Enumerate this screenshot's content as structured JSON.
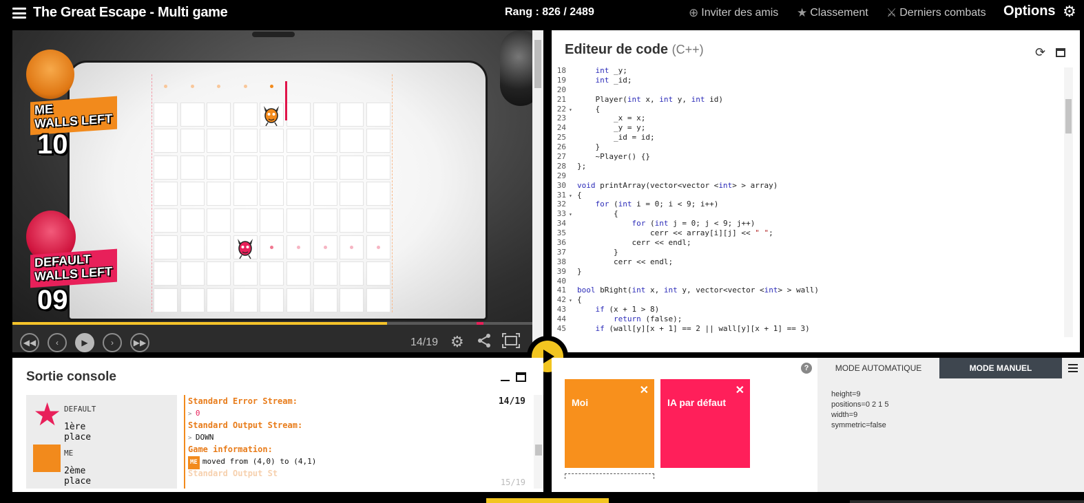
{
  "app": {
    "title": "The Great Escape - Multi game",
    "rank": "Rang : 826 / 2489",
    "links": {
      "invite": "Inviter des amis",
      "ranking": "Classement",
      "fights": "Derniers combats"
    },
    "options": "Options"
  },
  "viewer": {
    "hud": {
      "me": {
        "name": "ME",
        "walls_label": "WALLS LEFT",
        "walls_left": "10"
      },
      "default": {
        "name": "DEFAULT",
        "walls_label": "WALLS LEFT",
        "walls_left": "09"
      }
    },
    "frame": "14/19",
    "progress": 0.72,
    "board_size": 9,
    "me_pawn": {
      "col": 4,
      "row": 1
    },
    "default_pawn": {
      "col": 3,
      "row": 6
    },
    "wall": {
      "col": 5,
      "row": 0,
      "span": 2,
      "orientation": "V"
    }
  },
  "editor": {
    "title": "Editeur de code",
    "lang": "(C++)",
    "lines": [
      {
        "n": "18",
        "fold": "",
        "t": "    int _y;"
      },
      {
        "n": "19",
        "fold": "",
        "t": "    int _id;"
      },
      {
        "n": "20",
        "fold": "",
        "t": ""
      },
      {
        "n": "21",
        "fold": "",
        "t": "    Player(int x, int y, int id)"
      },
      {
        "n": "22",
        "fold": "▾",
        "t": "    {"
      },
      {
        "n": "23",
        "fold": "",
        "t": "        _x = x;"
      },
      {
        "n": "24",
        "fold": "",
        "t": "        _y = y;"
      },
      {
        "n": "25",
        "fold": "",
        "t": "        _id = id;"
      },
      {
        "n": "26",
        "fold": "",
        "t": "    }"
      },
      {
        "n": "27",
        "fold": "",
        "t": "    ~Player() {}"
      },
      {
        "n": "28",
        "fold": "",
        "t": "};"
      },
      {
        "n": "29",
        "fold": "",
        "t": ""
      },
      {
        "n": "30",
        "fold": "",
        "t": "void printArray(vector<vector <int> > array)"
      },
      {
        "n": "31",
        "fold": "▾",
        "t": "{"
      },
      {
        "n": "32",
        "fold": "",
        "t": "    for (int i = 0; i < 9; i++)"
      },
      {
        "n": "33",
        "fold": "▾",
        "t": "        {"
      },
      {
        "n": "34",
        "fold": "",
        "t": "            for (int j = 0; j < 9; j++)"
      },
      {
        "n": "35",
        "fold": "",
        "t": "                cerr << array[i][j] << \" \";"
      },
      {
        "n": "36",
        "fold": "",
        "t": "            cerr << endl;"
      },
      {
        "n": "37",
        "fold": "",
        "t": "        }"
      },
      {
        "n": "38",
        "fold": "",
        "t": "        cerr << endl;"
      },
      {
        "n": "39",
        "fold": "",
        "t": "}"
      },
      {
        "n": "40",
        "fold": "",
        "t": ""
      },
      {
        "n": "41",
        "fold": "",
        "t": "bool bRight(int x, int y, vector<vector <int> > wall)"
      },
      {
        "n": "42",
        "fold": "▾",
        "t": "{"
      },
      {
        "n": "43",
        "fold": "",
        "t": "    if (x + 1 > 8)"
      },
      {
        "n": "44",
        "fold": "",
        "t": "        return (false);"
      },
      {
        "n": "45",
        "fold": "",
        "t": "    if (wall[y][x + 1] == 2 || wall[y][x + 1] == 3)"
      }
    ]
  },
  "console": {
    "title": "Sortie console",
    "ranking": [
      {
        "name": "DEFAULT",
        "place": "1ère place"
      },
      {
        "name": "ME",
        "place": "2ème place"
      }
    ],
    "counter": "14/19",
    "next_counter": "15/19",
    "stderr_label": "Standard Error Stream:",
    "stderr_value": "0",
    "stdout_label": "Standard Output Stream:",
    "stdout_value": "DOWN",
    "info_label": "Game information:",
    "info_tag": "ME",
    "info_value": "moved from (4,0) to (4,1)",
    "next_label": "Standard Output St"
  },
  "players": {
    "me": "Moi",
    "ia": "IA par défaut"
  },
  "params": {
    "tab_auto": "MODE AUTOMATIQUE",
    "tab_manual": "MODE MANUEL",
    "lines": [
      "height=9",
      "positions=0 2 1 5",
      "width=9",
      "symmetric=false"
    ]
  },
  "colors": {
    "accent": "#f2c520",
    "me": "#f28a1c",
    "default": "#e8205a"
  }
}
